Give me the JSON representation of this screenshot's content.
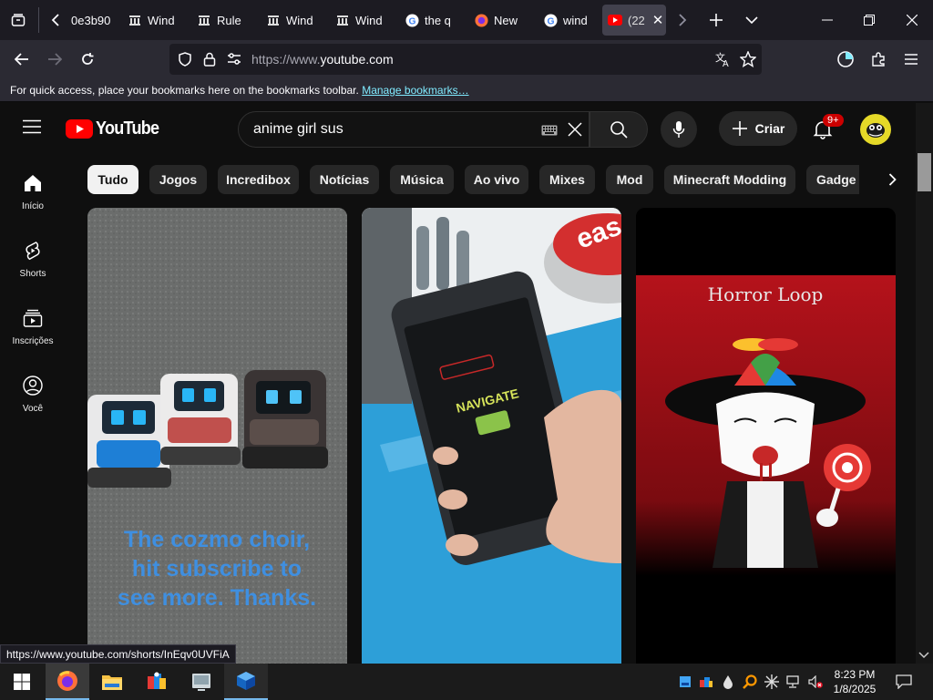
{
  "browser": {
    "tabs": [
      {
        "label": "0e3b90",
        "icon": "generic-icon"
      },
      {
        "label": "Wind",
        "icon": "wiki-icon"
      },
      {
        "label": "Rule",
        "icon": "wiki-icon"
      },
      {
        "label": "Wind",
        "icon": "wiki-icon"
      },
      {
        "label": "Wind",
        "icon": "wiki-icon"
      },
      {
        "label": "the q",
        "icon": "google-icon"
      },
      {
        "label": "New",
        "icon": "firefox-icon"
      },
      {
        "label": "wind",
        "icon": "google-icon"
      },
      {
        "label": "(22",
        "icon": "youtube-icon",
        "active": true
      }
    ],
    "url_prefix": "https://www.",
    "url_domain": "youtube.com",
    "bookmarks_message": "For quick access, place your bookmarks here on the bookmarks toolbar.",
    "bookmarks_link": "Manage bookmarks…",
    "status_url": "https://www.youtube.com/shorts/InEqv0UVFiA"
  },
  "youtube": {
    "logo_text": "YouTube",
    "search_query": "anime girl sus",
    "create_label": "Criar",
    "notification_count": "9+",
    "sidebar": [
      {
        "label": "Início",
        "icon": "home-icon"
      },
      {
        "label": "Shorts",
        "icon": "shorts-icon"
      },
      {
        "label": "Inscrições",
        "icon": "subscriptions-icon"
      },
      {
        "label": "Você",
        "icon": "user-icon"
      }
    ],
    "chips": [
      "Tudo",
      "Jogos",
      "Incredibox",
      "Notícias",
      "Música",
      "Ao vivo",
      "Mixes",
      "Mod",
      "Minecraft Modding",
      "Gadge"
    ],
    "selected_chip": "Tudo",
    "cards": [
      {
        "overlay_text_lines": [
          "The cozmo choir,",
          "hit subscribe to",
          "see more. Thanks."
        ]
      },
      {
        "button_text": "eas",
        "screen_text": "NAVIGATE"
      },
      {
        "title_text": "Horror Loop"
      }
    ]
  },
  "taskbar": {
    "apps": [
      "start-icon",
      "firefox-icon",
      "file-explorer-icon",
      "app-icon",
      "explorer-icon",
      "virtualbox-icon"
    ],
    "time": "8:23 PM",
    "date": "1/8/2025"
  },
  "colors": {
    "youtube_red": "#ff0000",
    "link": "#80ebff",
    "cozmo_text": "#3f8fe0",
    "horror_red": "#b5121b"
  }
}
